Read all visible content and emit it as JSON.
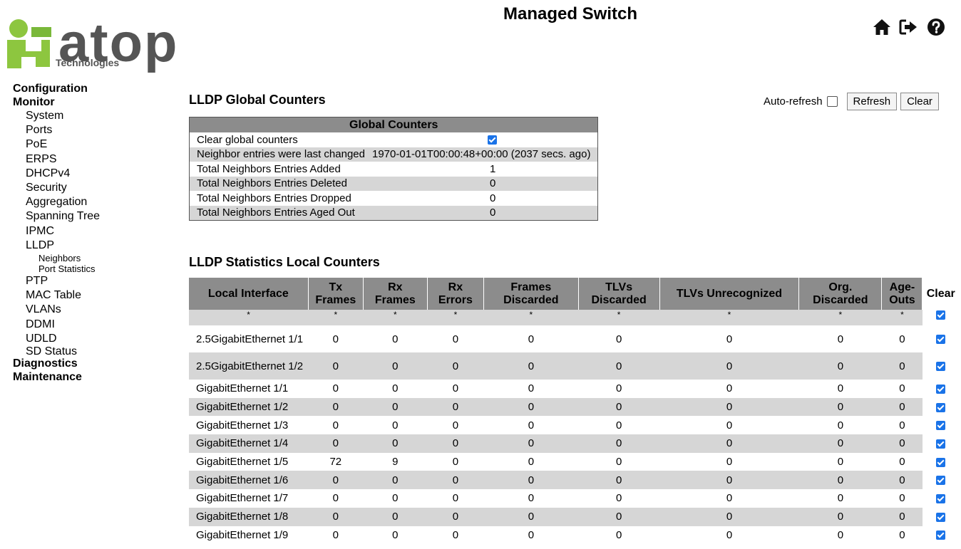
{
  "header": {
    "title": "Managed Switch",
    "logo_text": "atop",
    "logo_sub": "Technologies",
    "icons": [
      "home-icon",
      "logout-icon",
      "help-icon"
    ]
  },
  "sidebar": {
    "top": [
      "Configuration",
      "Monitor"
    ],
    "monitor_items": [
      "System",
      "Ports",
      "PoE",
      "ERPS",
      "DHCPv4",
      "Security",
      "Aggregation",
      "Spanning Tree",
      "IPMC",
      "LLDP"
    ],
    "lldp_items": [
      "Neighbors",
      "Port Statistics"
    ],
    "monitor_items_after": [
      "PTP",
      "MAC Table",
      "VLANs",
      "DDMI",
      "UDLD",
      "SD Status"
    ],
    "bottom": [
      "Diagnostics",
      "Maintenance"
    ]
  },
  "toolbar": {
    "auto_refresh_label": "Auto-refresh",
    "refresh_label": "Refresh",
    "clear_label": "Clear"
  },
  "global": {
    "section_title": "LLDP Global Counters",
    "table_header": "Global Counters",
    "rows": [
      {
        "label": "Clear global counters",
        "value": ""
      },
      {
        "label": "Neighbor entries were last changed",
        "value": "1970-01-01T00:00:48+00:00 (2037 secs. ago)"
      },
      {
        "label": "Total Neighbors Entries Added",
        "value": "1"
      },
      {
        "label": "Total Neighbors Entries Deleted",
        "value": "0"
      },
      {
        "label": "Total Neighbors Entries Dropped",
        "value": "0"
      },
      {
        "label": "Total Neighbors Entries Aged Out",
        "value": "0"
      }
    ]
  },
  "local": {
    "section_title": "LLDP Statistics Local Counters",
    "columns": [
      "Local Interface",
      "Tx Frames",
      "Rx Frames",
      "Rx Errors",
      "Frames Discarded",
      "TLVs Discarded",
      "TLVs Unrecognized",
      "Org. Discarded",
      "Age-Outs",
      "Clear"
    ],
    "wildcard": "*",
    "rows": [
      [
        "2.5GigabitEthernet 1/1",
        "0",
        "0",
        "0",
        "0",
        "0",
        "0",
        "0",
        "0"
      ],
      [
        "2.5GigabitEthernet 1/2",
        "0",
        "0",
        "0",
        "0",
        "0",
        "0",
        "0",
        "0"
      ],
      [
        "GigabitEthernet 1/1",
        "0",
        "0",
        "0",
        "0",
        "0",
        "0",
        "0",
        "0"
      ],
      [
        "GigabitEthernet 1/2",
        "0",
        "0",
        "0",
        "0",
        "0",
        "0",
        "0",
        "0"
      ],
      [
        "GigabitEthernet 1/3",
        "0",
        "0",
        "0",
        "0",
        "0",
        "0",
        "0",
        "0"
      ],
      [
        "GigabitEthernet 1/4",
        "0",
        "0",
        "0",
        "0",
        "0",
        "0",
        "0",
        "0"
      ],
      [
        "GigabitEthernet 1/5",
        "72",
        "9",
        "0",
        "0",
        "0",
        "0",
        "0",
        "0"
      ],
      [
        "GigabitEthernet 1/6",
        "0",
        "0",
        "0",
        "0",
        "0",
        "0",
        "0",
        "0"
      ],
      [
        "GigabitEthernet 1/7",
        "0",
        "0",
        "0",
        "0",
        "0",
        "0",
        "0",
        "0"
      ],
      [
        "GigabitEthernet 1/8",
        "0",
        "0",
        "0",
        "0",
        "0",
        "0",
        "0",
        "0"
      ],
      [
        "GigabitEthernet 1/9",
        "0",
        "0",
        "0",
        "0",
        "0",
        "0",
        "0",
        "0"
      ]
    ]
  },
  "colors": {
    "header_bg": "#8c8c8c",
    "row_alt": "#d6d6d6",
    "checkbox": "#1a73e8",
    "logo_green": "#8dc63f"
  }
}
